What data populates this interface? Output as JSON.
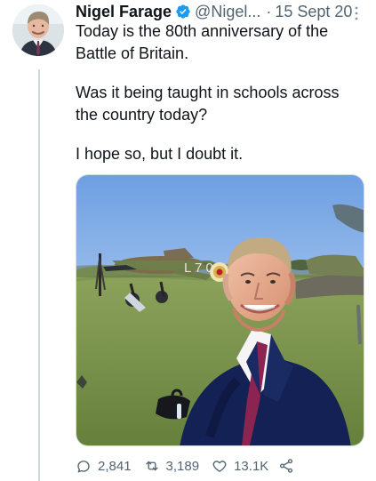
{
  "tweet": {
    "author": {
      "display_name": "Nigel Farage",
      "handle": "@Nigel...",
      "verified": true,
      "avatar_icon": "avatar-portrait"
    },
    "separator": "·",
    "timestamp": "15 Sept 20",
    "more_icon": "more-icon",
    "text": {
      "paragraphs": [
        "Today is the 80th anniversary of the\nBattle of Britain.",
        "Was it being taught in schools across\nthe country today?",
        "I hope so, but I doubt it."
      ]
    },
    "media": {
      "type": "photo",
      "aircraft_marking": "L 7 0"
    },
    "actions": {
      "reply_count": "2,841",
      "retweet_count": "3,189",
      "like_count": "13.1K",
      "share_icon": "share-icon"
    }
  },
  "colors": {
    "text_primary": "#0f1419",
    "text_secondary": "#536471",
    "verified": "#1d9bf0",
    "thread_line": "#cfd9de"
  }
}
